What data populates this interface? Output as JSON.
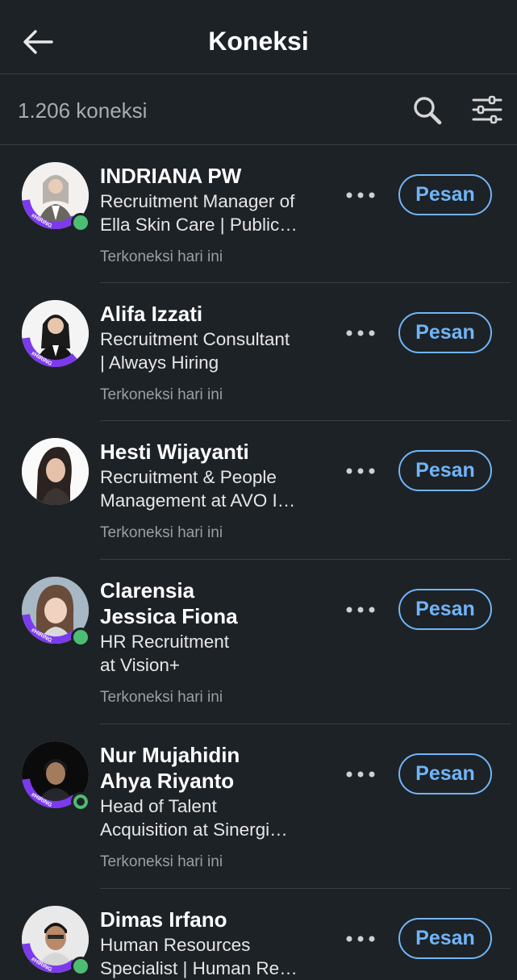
{
  "header": {
    "title": "Koneksi",
    "back_icon": "arrow-left-icon"
  },
  "toolbar": {
    "count_label": "1.206 koneksi",
    "search_icon": "search-icon",
    "filter_icon": "sliders-icon"
  },
  "colors": {
    "background": "#1d2226",
    "accent": "#70b5f9",
    "hiring_ring": "#7c3aed",
    "presence": "#4dbd74"
  },
  "connections": [
    {
      "name": "INDRIANA PW",
      "headline": [
        "Recruitment Manager of",
        "Ella Skin Care | Public…"
      ],
      "meta": "Terkoneksi hari ini",
      "hiring_badge": "#HIRING",
      "online": true,
      "button": "Pesan"
    },
    {
      "name": "Alifa Izzati",
      "headline": [
        "Recruitment Consultant",
        "| Always Hiring"
      ],
      "meta": "Terkoneksi hari ini",
      "hiring_badge": "#HIRING",
      "online": false,
      "button": "Pesan"
    },
    {
      "name": "Hesti Wijayanti",
      "headline": [
        "Recruitment & People",
        "Management at AVO I…"
      ],
      "meta": "Terkoneksi hari ini",
      "hiring_badge": "",
      "online": false,
      "button": "Pesan"
    },
    {
      "name_lines": [
        "Clarensia",
        "Jessica Fiona"
      ],
      "headline": [
        "HR Recruitment",
        "at Vision+"
      ],
      "meta": "Terkoneksi hari ini",
      "hiring_badge": "#HIRING",
      "online": true,
      "button": "Pesan"
    },
    {
      "name_lines": [
        "Nur Mujahidin",
        "Ahya Riyanto"
      ],
      "headline": [
        "Head of Talent",
        "Acquisition at Sinergi…"
      ],
      "meta": "Terkoneksi hari ini",
      "hiring_badge": "#HIRING",
      "online": true,
      "button": "Pesan"
    },
    {
      "name": "Dimas Irfano",
      "headline": [
        "Human Resources",
        "Specialist | Human Re…"
      ],
      "meta": "",
      "hiring_badge": "#HIRING",
      "online": true,
      "button": "Pesan"
    }
  ]
}
